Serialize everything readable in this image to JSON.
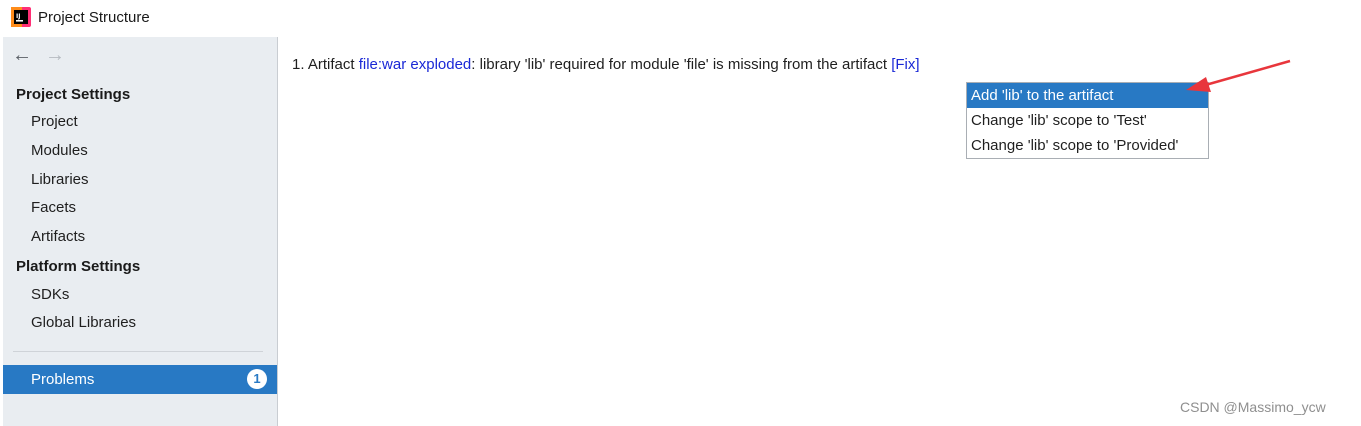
{
  "window": {
    "title": "Project Structure"
  },
  "sidebar": {
    "project_settings_header": "Project Settings",
    "project_settings_items": [
      "Project",
      "Modules",
      "Libraries",
      "Facets",
      "Artifacts"
    ],
    "platform_settings_header": "Platform Settings",
    "platform_settings_items": [
      "SDKs",
      "Global Libraries"
    ],
    "problems": {
      "label": "Problems",
      "count": "1"
    }
  },
  "main": {
    "problem": {
      "prefix": "1. Artifact ",
      "artifact_link": "file:war exploded",
      "message": ": library 'lib' required for module 'file' is missing from the artifact ",
      "fix_link": "[Fix]"
    },
    "fix_menu": {
      "options": [
        "Add 'lib' to the artifact",
        "Change 'lib' scope to 'Test'",
        "Change 'lib' scope to 'Provided'"
      ],
      "selected_index": 0
    }
  },
  "watermark": "CSDN @Massimo_ycw",
  "colors": {
    "accent": "#2879c4",
    "link": "#1a28d6",
    "sidebar_bg": "#e9edf1",
    "annotation_arrow": "#e8363c"
  },
  "icons": {
    "app": "intellij-idea-icon",
    "back": "back-arrow-icon",
    "forward": "forward-arrow-icon"
  }
}
